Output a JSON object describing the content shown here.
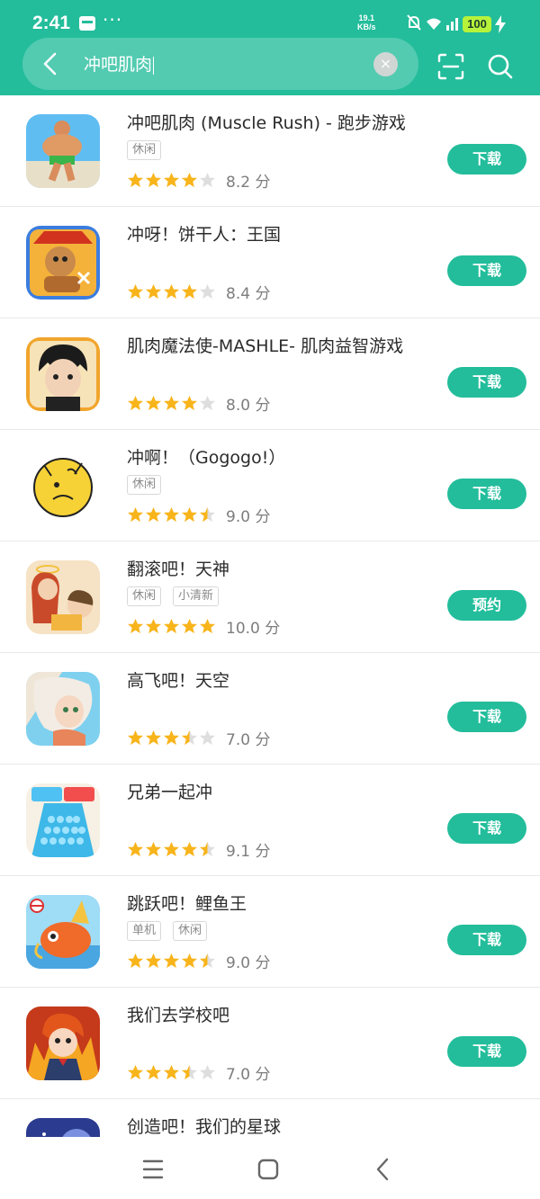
{
  "status_bar": {
    "time": "2:41",
    "dots": "···",
    "net_speed_value": "19.1",
    "net_speed_unit": "KB/s",
    "battery": "100"
  },
  "search": {
    "query": "冲吧肌肉",
    "clear_symbol": "×"
  },
  "colors": {
    "brand": "#23bd9b",
    "star": "#f8b41b",
    "star_empty": "#dedede"
  },
  "apps": [
    {
      "name": "冲吧肌肉 (Muscle Rush) - 跑步游戏",
      "tags": [
        "休闲"
      ],
      "rating_stars": 4,
      "score": "8.2 分",
      "action": "下载"
    },
    {
      "name": "冲呀！饼干人：王国",
      "tags": [],
      "rating_stars": 4,
      "score": "8.4 分",
      "action": "下载"
    },
    {
      "name": "肌肉魔法使-MASHLE- 肌肉益智游戏",
      "tags": [],
      "rating_stars": 4,
      "score": "8.0 分",
      "action": "下载"
    },
    {
      "name": "冲啊！（Gogogo!）",
      "tags": [
        "休闲"
      ],
      "rating_stars": 4.5,
      "score": "9.0 分",
      "action": "下载"
    },
    {
      "name": "翻滚吧！天神",
      "tags": [
        "休闲",
        "小清新"
      ],
      "rating_stars": 5,
      "score": "10.0 分",
      "action": "预约"
    },
    {
      "name": "高飞吧！天空",
      "tags": [],
      "rating_stars": 3.5,
      "score": "7.0 分",
      "action": "下载"
    },
    {
      "name": "兄弟一起冲",
      "tags": [],
      "rating_stars": 4.5,
      "score": "9.1 分",
      "action": "下载"
    },
    {
      "name": "跳跃吧！鲤鱼王",
      "tags": [
        "单机",
        "休闲"
      ],
      "rating_stars": 4.5,
      "score": "9.0 分",
      "action": "下载"
    },
    {
      "name": "我们去学校吧",
      "tags": [],
      "rating_stars": 3.5,
      "score": "7.0 分",
      "action": "下载"
    },
    {
      "name": "创造吧！我们的星球",
      "tags": [],
      "rating_stars": 0,
      "score": "",
      "action": ""
    }
  ],
  "icon_names": [
    "muscle-rush-icon",
    "cookie-run-icon",
    "mashle-icon",
    "gogogo-icon",
    "tianshen-icon",
    "gaofei-icon",
    "brothers-rush-icon",
    "magikarp-icon",
    "school-icon",
    "planet-icon"
  ],
  "nav": {
    "menu": "menu-icon",
    "home": "home-icon",
    "back": "back-icon"
  }
}
